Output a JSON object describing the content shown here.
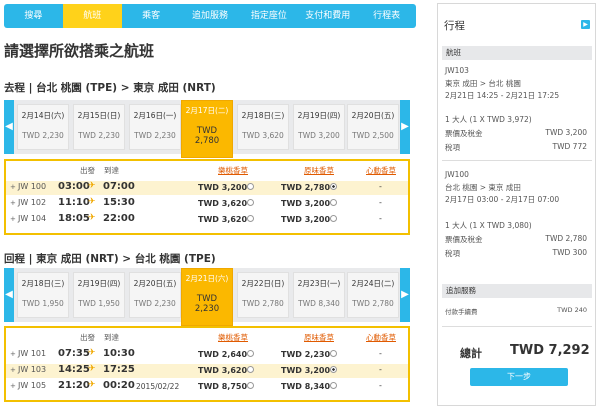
{
  "nav": [
    "搜尋",
    "航班",
    "乘客",
    "追加服務",
    "指定座位",
    "支付和費用",
    "行程表"
  ],
  "page_title": "請選擇所欲搭乘之航班",
  "outbound": {
    "route": "去程 | 台北 桃園 (TPE) > 東京 成田 (NRT)",
    "dates": [
      {
        "date": "2月14日(六)",
        "price": "TWD 2,230"
      },
      {
        "date": "2月15日(日)",
        "price": "TWD 2,230"
      },
      {
        "date": "2月16日(一)",
        "price": "TWD 2,230"
      },
      {
        "date": "2月17日(二)",
        "currency": "TWD",
        "price": "2,780"
      },
      {
        "date": "2月18日(三)",
        "price": "TWD 3,620"
      },
      {
        "date": "2月19日(四)",
        "price": "TWD 3,200"
      },
      {
        "date": "2月20日(五)",
        "price": "TWD 2,500"
      }
    ],
    "headers": {
      "depart": "出發",
      "arrive": "到達",
      "fare1": "樂桃香草",
      "fare2": "原味香草",
      "fare3": "心動香草"
    },
    "flights": [
      {
        "tag": "+",
        "no": "JW 100",
        "dep": "03:00",
        "arr": "07:00",
        "extra": "",
        "fare1": "TWD 3,200",
        "fare2": "TWD 2,780",
        "fare3": "-",
        "selected": true
      },
      {
        "tag": "+",
        "no": "JW 102",
        "dep": "11:10",
        "arr": "15:30",
        "extra": "",
        "fare1": "TWD 3,620",
        "fare2": "TWD 3,200",
        "fare3": "-",
        "selected": false
      },
      {
        "tag": "+",
        "no": "JW 104",
        "dep": "18:05",
        "arr": "22:00",
        "extra": "",
        "fare1": "TWD 3,620",
        "fare2": "TWD 3,200",
        "fare3": "-",
        "selected": false
      }
    ]
  },
  "inbound": {
    "route": "回程 | 東京 成田 (NRT) > 台北 桃園 (TPE)",
    "dates": [
      {
        "date": "2月18日(三)",
        "price": "TWD 1,950"
      },
      {
        "date": "2月19日(四)",
        "price": "TWD 1,950"
      },
      {
        "date": "2月20日(五)",
        "price": "TWD 2,230"
      },
      {
        "date": "2月21日(六)",
        "currency": "TWD",
        "price": "2,230"
      },
      {
        "date": "2月22日(日)",
        "price": "TWD 2,780"
      },
      {
        "date": "2月23日(一)",
        "price": "TWD 8,340"
      },
      {
        "date": "2月24日(二)",
        "price": "TWD 2,780"
      }
    ],
    "headers": {
      "depart": "出發",
      "arrive": "到達",
      "fare1": "樂桃香草",
      "fare2": "原味香草",
      "fare3": "心動香草"
    },
    "flights": [
      {
        "tag": "+",
        "no": "JW 101",
        "dep": "07:35",
        "arr": "10:30",
        "extra": "",
        "fare1": "TWD 2,640",
        "fare2": "TWD 2,230",
        "fare3": "-",
        "selected": false
      },
      {
        "tag": "+",
        "no": "JW 103",
        "dep": "14:25",
        "arr": "17:25",
        "extra": "",
        "fare1": "TWD 3,620",
        "fare2": "TWD 3,200",
        "fare3": "-",
        "selected": true
      },
      {
        "tag": "+",
        "no": "JW 105",
        "dep": "21:20",
        "arr": "00:20",
        "extra": "2015/02/22",
        "fare1": "TWD 8,750",
        "fare2": "TWD 8,340",
        "fare3": "-",
        "selected": false
      }
    ]
  },
  "itinerary": {
    "title": "行程",
    "flight_header": "航班",
    "leg1": {
      "no": "JW103",
      "route": "東京 成田 > 台北 桃園",
      "time": "2月21日 14:25 - 2月21日 17:25",
      "pax": "1 大人 (1 X TWD 3,972)",
      "fare_label": "票價及稅金",
      "fare": "TWD 3,200",
      "tax_label": "稅項",
      "tax": "TWD 772"
    },
    "leg2": {
      "no": "JW100",
      "route": "台北 桃園 > 東京 成田",
      "time": "2月17日 03:00 - 2月17日 07:00",
      "pax": "1 大人 (1 X TWD 3,080)",
      "fare_label": "票價及稅金",
      "fare": "TWD 2,780",
      "tax_label": "稅項",
      "tax": "TWD 300"
    },
    "extra_header": "追加服務",
    "fee_label": "付款手續費",
    "fee": "TWD 240",
    "total_label": "總計",
    "total": "TWD 7,292",
    "next_label": "下一步"
  },
  "colors": {
    "accent": "#2cb7e8",
    "selected": "#fbb800"
  }
}
